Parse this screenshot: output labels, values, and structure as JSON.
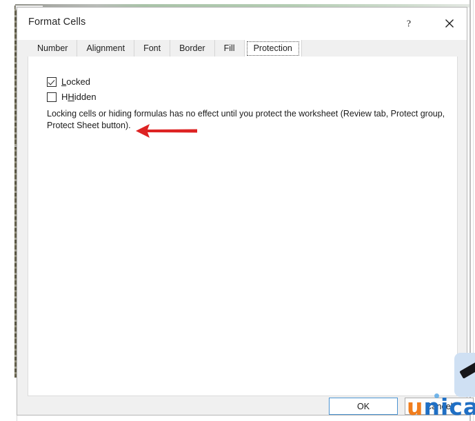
{
  "window": {
    "title": "Format Cells",
    "help_icon": "question-mark-icon",
    "close_icon": "close-x-icon"
  },
  "tabs": [
    {
      "label": "Number",
      "selected": false
    },
    {
      "label": "Alignment",
      "selected": false
    },
    {
      "label": "Font",
      "selected": false
    },
    {
      "label": "Border",
      "selected": false
    },
    {
      "label": "Fill",
      "selected": false
    },
    {
      "label": "Protection",
      "selected": true
    }
  ],
  "protection": {
    "checkboxes": [
      {
        "label": "Locked",
        "accel": "L",
        "rest": "ocked",
        "checked": true
      },
      {
        "label": "Hidden",
        "accel": "H",
        "pre": "H",
        "rest": "idden",
        "checked": false
      }
    ],
    "description": "Locking cells or hiding formulas has no effect until you protect the worksheet (Review tab, Protect group, Protect Sheet button)."
  },
  "annotation": {
    "arrow_icon": "red-left-arrow-annotation",
    "color": "#dd2222"
  },
  "footer": {
    "ok_label": "OK",
    "cancel_label": "Cancel"
  },
  "watermark": {
    "part1": "u",
    "part2": "n",
    "part3": "i",
    "part4": "c",
    "part5": "a",
    "color_orange": "#f07d1d",
    "color_blue": "#1f6fc4"
  },
  "edge_widget": {
    "icon": "pen-cursor-icon",
    "background": "#cfe0f3"
  }
}
